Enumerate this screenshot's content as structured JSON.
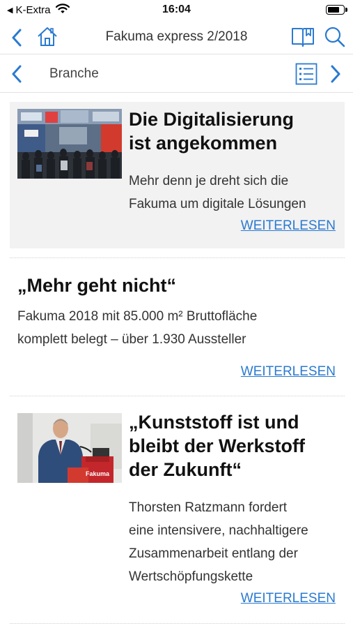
{
  "status_bar": {
    "carrier": "K-Extra",
    "time": "16:04",
    "battery_level": 0.8
  },
  "nav": {
    "title": "Fakuma express 2/2018"
  },
  "section": {
    "label": "Branche"
  },
  "articles": [
    {
      "title_lines": [
        "Die Digitalisierung",
        "ist angekommen"
      ],
      "text_lines": [
        "Mehr denn je dreht sich die",
        "Fakuma um digitale Lösungen"
      ],
      "read_more": "WEITERLESEN"
    },
    {
      "title_lines": [
        "„Mehr geht nicht“"
      ],
      "text_lines": [
        "Fakuma 2018 mit 85.000 m² Bruttofläche",
        "komplett belegt – über 1.930 Aussteller"
      ],
      "read_more": "WEITERLESEN"
    },
    {
      "title_lines": [
        "„Kunststoff ist und",
        "bleibt der Werkstoff",
        "der Zukunft“"
      ],
      "text_lines": [
        "Thorsten Ratzmann fordert",
        "eine intensivere, nachhaltigere",
        "Zusammenarbeit entlang der",
        "Wertschöpfungskette"
      ],
      "read_more": "WEITERLESEN",
      "image_sign": "Fakuma"
    }
  ],
  "colors": {
    "accent": "#2a7ad0",
    "highlight_bg": "#f2f2f2"
  }
}
